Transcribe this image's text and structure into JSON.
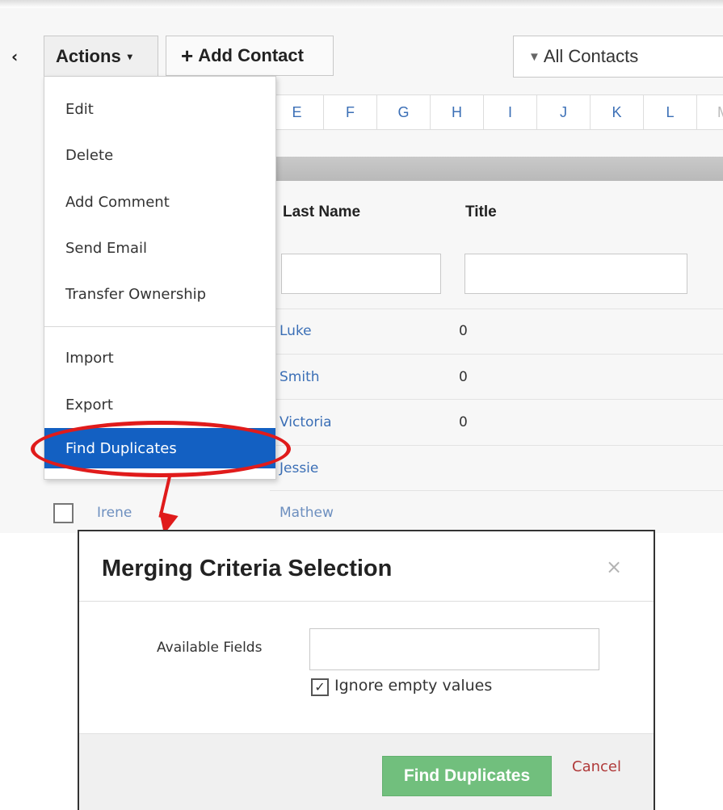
{
  "toolbar": {
    "back_glyph": "‹",
    "actions_label": "Actions",
    "actions_caret": "▾",
    "add_contact_icon": "plus-icon",
    "add_contact_label": "Add Contact",
    "filter_icon": "funnel-icon",
    "filter_label": "All Contacts"
  },
  "alphabet": [
    "E",
    "F",
    "G",
    "H",
    "I",
    "J",
    "K",
    "L",
    "M"
  ],
  "table": {
    "columns": [
      "Last Name",
      "Title"
    ],
    "rows": [
      {
        "last_name": "Luke",
        "title": "0"
      },
      {
        "last_name": "Smith",
        "title": "0"
      },
      {
        "last_name": "Victoria",
        "title": "0"
      },
      {
        "last_name": "Jessie",
        "title": ""
      },
      {
        "first_name": "Irene",
        "last_name": "Mathew",
        "title": ""
      }
    ]
  },
  "actions_menu": {
    "items": [
      "Edit",
      "Delete",
      "Add Comment",
      "Send Email",
      "Transfer Ownership",
      "Import",
      "Export",
      "Find Duplicates"
    ],
    "highlighted": "Find Duplicates",
    "highlight_color": "#1360c2"
  },
  "annotation": {
    "color": "#e01b1b"
  },
  "modal": {
    "title": "Merging Criteria Selection",
    "close_glyph": "×",
    "field_label": "Available Fields",
    "field_value": "",
    "ignore_empty_label": "Ignore empty values",
    "ignore_empty_checked": true,
    "checkmark": "✓",
    "find_button_label": "Find Duplicates",
    "find_button_color": "#71bf7d",
    "cancel_label": "Cancel"
  }
}
